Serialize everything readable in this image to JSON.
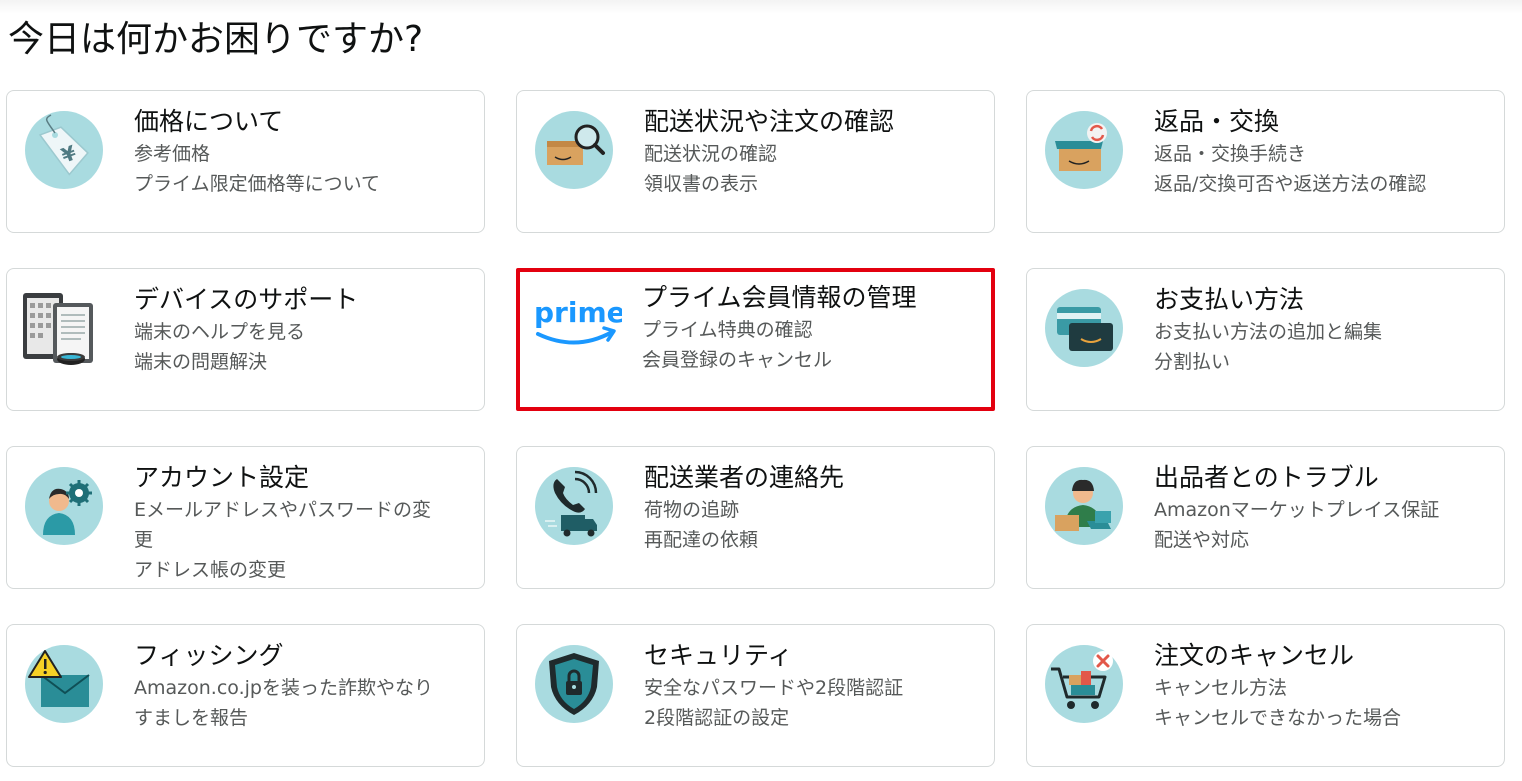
{
  "page": {
    "title": "今日は何かお困りですか?"
  },
  "colors": {
    "icon_bg": "#a9dbe0",
    "highlight_border": "#e3000f",
    "card_border": "#d5d9d9",
    "prime_blue": "#1a98ff"
  },
  "cards": [
    {
      "title": "価格について",
      "lines": [
        "参考価格",
        "プライム限定価格等について"
      ],
      "icon": "price-tag-yen-icon"
    },
    {
      "title": "配送状況や注文の確認",
      "lines": [
        "配送状況の確認",
        "領収書の表示"
      ],
      "icon": "package-search-icon"
    },
    {
      "title": "返品・交換",
      "lines": [
        "返品・交換手続き",
        "返品/交換可否や返送方法の確認"
      ],
      "icon": "return-box-icon"
    },
    {
      "title": "デバイスのサポート",
      "lines": [
        "端末のヘルプを見る",
        "端末の問題解決"
      ],
      "icon": "devices-icon"
    },
    {
      "title": "プライム会員情報の管理",
      "lines": [
        "プライム特典の確認",
        "会員登録のキャンセル"
      ],
      "icon": "prime-logo-icon",
      "prime_text": "prime",
      "selected": true
    },
    {
      "title": "お支払い方法",
      "lines": [
        "お支払い方法の追加と編集",
        "分割払い"
      ],
      "icon": "credit-card-icon"
    },
    {
      "title": "アカウント設定",
      "lines": [
        "Eメールアドレスやパスワードの変",
        "更",
        "アドレス帳の変更"
      ],
      "icon": "account-settings-icon"
    },
    {
      "title": "配送業者の連絡先",
      "lines": [
        "荷物の追跡",
        "再配達の依頼"
      ],
      "icon": "delivery-phone-icon"
    },
    {
      "title": "出品者とのトラブル",
      "lines": [
        "Amazonマーケットプレイス保証",
        "配送や対応"
      ],
      "icon": "seller-icon"
    },
    {
      "title": "フィッシング",
      "lines": [
        "Amazon.co.jpを装った詐欺やなり",
        "すましを報告"
      ],
      "icon": "phishing-warning-mail-icon"
    },
    {
      "title": "セキュリティ",
      "lines": [
        "安全なパスワードや2段階認証",
        "2段階認証の設定"
      ],
      "icon": "security-shield-icon"
    },
    {
      "title": "注文のキャンセル",
      "lines": [
        "キャンセル方法",
        "キャンセルできなかった場合"
      ],
      "icon": "cart-cancel-icon"
    }
  ]
}
